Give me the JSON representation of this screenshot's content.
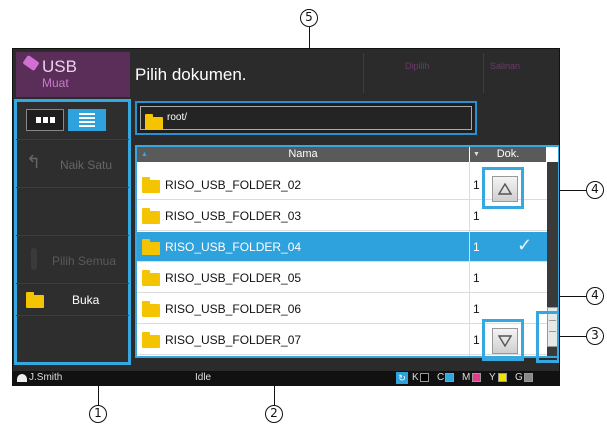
{
  "header": {
    "usb_label": "USB",
    "usb_sublabel": "Muat",
    "title": "Pilih dokumen.",
    "selected_label": "Dipilih",
    "copies_label": "Salinan"
  },
  "sidebar": {
    "up_label": "Naik Satu",
    "select_all_label": "Pilih Semua",
    "open_label": "Buka"
  },
  "path": {
    "current": "root/"
  },
  "list": {
    "col_name": "Nama",
    "col_docs": "Dok.",
    "rows": [
      {
        "name": "RISO_USB_FOLDER_02",
        "docs": "1"
      },
      {
        "name": "RISO_USB_FOLDER_03",
        "docs": "1"
      },
      {
        "name": "RISO_USB_FOLDER_04",
        "docs": "1",
        "selected": true
      },
      {
        "name": "RISO_USB_FOLDER_05",
        "docs": "1"
      },
      {
        "name": "RISO_USB_FOLDER_06",
        "docs": "1"
      },
      {
        "name": "RISO_USB_FOLDER_07",
        "docs": "1"
      }
    ]
  },
  "status": {
    "user": "J.Smith",
    "state": "Idle",
    "inks": [
      "K",
      "C",
      "M",
      "Y",
      "G"
    ],
    "ink_colors": [
      "#000000",
      "#2ea7e0",
      "#e23a8f",
      "#f1e400",
      "#888888"
    ]
  },
  "callouts": [
    "5",
    "4",
    "4",
    "3",
    "1",
    "2"
  ],
  "colors": {
    "accent": "#35a8e0",
    "usb_tile": "#5b2e5a",
    "selected_row": "#2ea2dd"
  }
}
